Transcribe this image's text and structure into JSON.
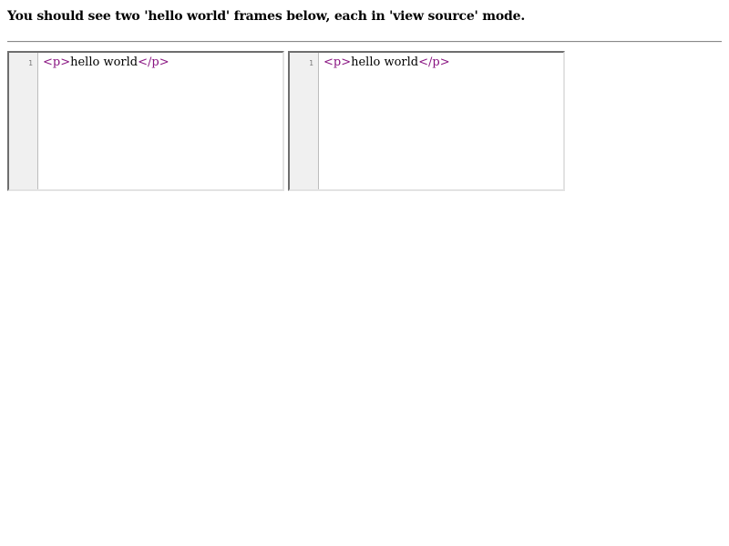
{
  "page": {
    "heading": "You should see two 'hello world' frames below, each in 'view source' mode."
  },
  "frames": [
    {
      "line_number": "1",
      "open_tag": "<p>",
      "content": "hello world",
      "close_tag": "</p>"
    },
    {
      "line_number": "1",
      "open_tag": "<p>",
      "content": "hello world",
      "close_tag": "</p>"
    }
  ],
  "colors": {
    "tag": "#881280",
    "gutter_bg": "#f0f0f0",
    "text": "#000000"
  }
}
